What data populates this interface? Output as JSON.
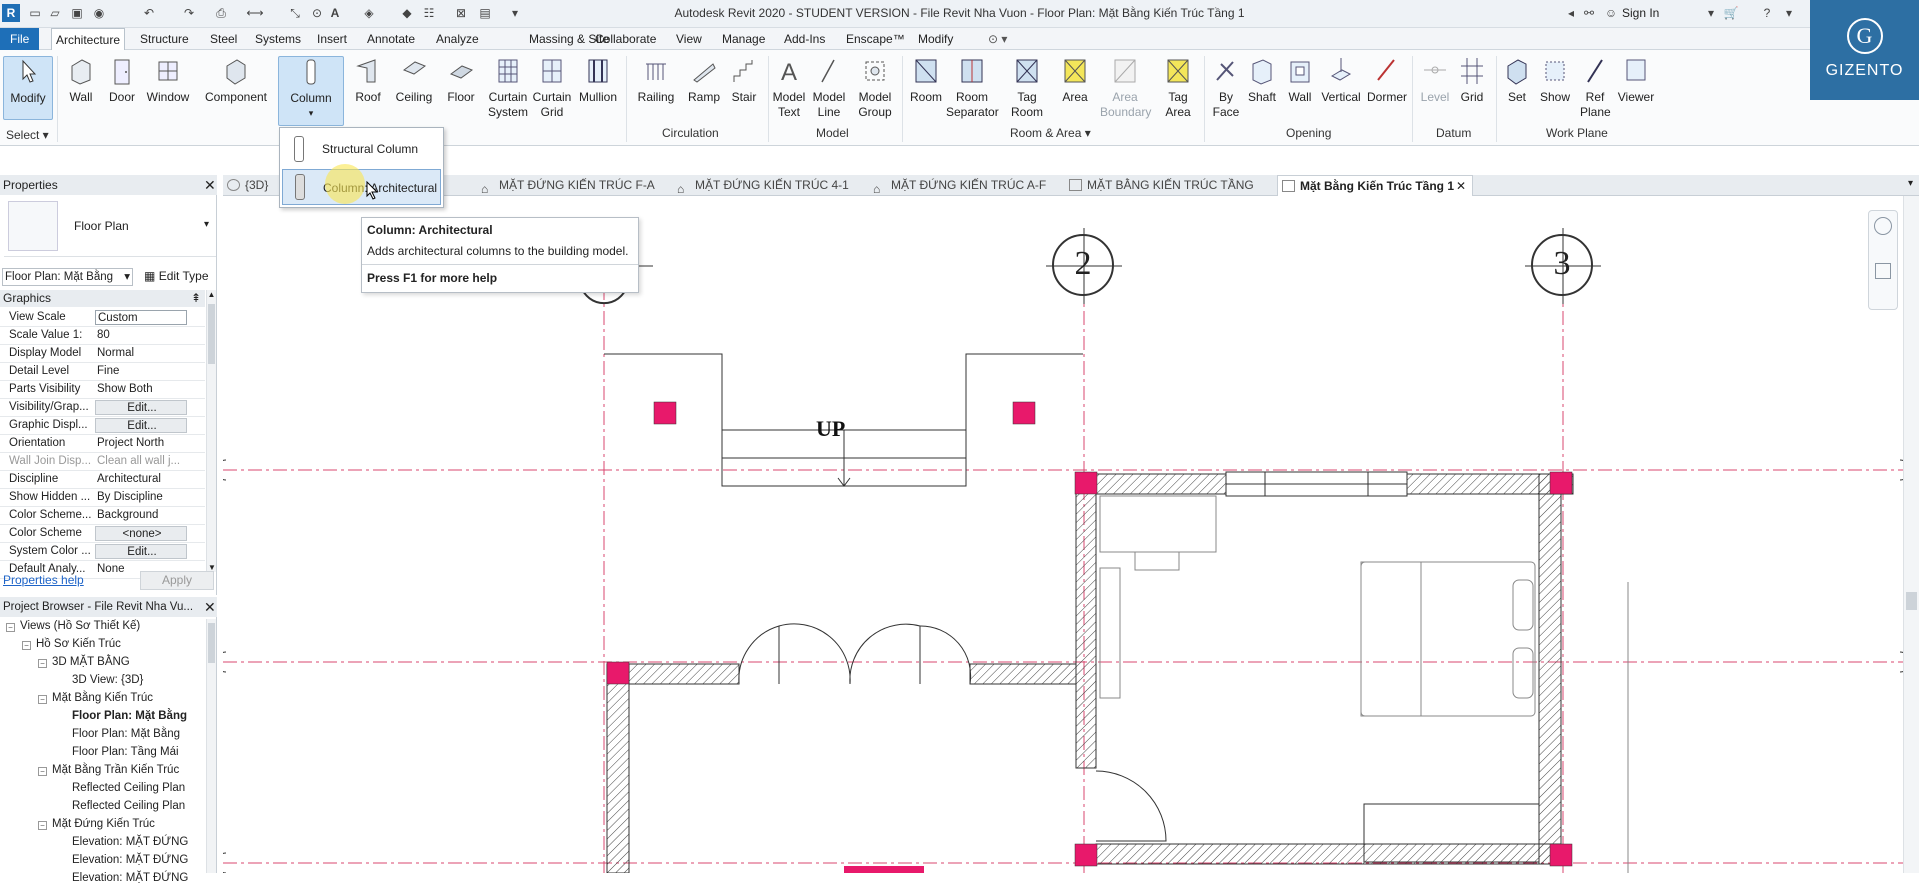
{
  "titlebar": {
    "title": "Autodesk Revit 2020 - STUDENT VERSION - File Revit Nha Vuon - Floor Plan: Mặt Bằng Kiến Trúc Tầng 1",
    "sign_in": "Sign In",
    "app_letter": "R"
  },
  "menu": {
    "items": [
      "File",
      "Architecture",
      "Structure",
      "Steel",
      "Systems",
      "Insert",
      "Annotate",
      "Analyze",
      "Massing & Site",
      "Collaborate",
      "View",
      "Manage",
      "Add-Ins",
      "Enscape™",
      "Modify"
    ]
  },
  "ribbon": {
    "buttons": {
      "modify": "Modify",
      "wall": "Wall",
      "door": "Door",
      "window": "Window",
      "component": "Component",
      "column": "Column",
      "roof": "Roof",
      "ceiling": "Ceiling",
      "floor": "Floor",
      "curtain_system": "Curtain System",
      "curtain_grid": "Curtain Grid",
      "mullion": "Mullion",
      "railing": "Railing",
      "ramp": "Ramp",
      "stair": "Stair",
      "model_text": "Model Text",
      "model_line": "Model Line",
      "model_group": "Model Group",
      "room": "Room",
      "room_separator": "Room Separator",
      "tag_room": "Tag Room",
      "area": "Area",
      "area_boundary": "Area Boundary",
      "tag_area": "Tag Area",
      "by_face": "By Face",
      "shaft": "Shaft",
      "wall_opening": "Wall",
      "vertical": "Vertical",
      "dormer": "Dormer",
      "level": "Level",
      "grid": "Grid",
      "set": "Set",
      "show": "Show",
      "ref_plane": "Ref Plane",
      "viewer": "Viewer"
    },
    "panels": {
      "select": "Select ▾",
      "circulation": "Circulation",
      "model": "Model",
      "room_area": "Room & Area ▾",
      "opening": "Opening",
      "datum": "Datum",
      "work_plane": "Work Plane"
    }
  },
  "logo": {
    "letter": "G",
    "name": "GIZENTO"
  },
  "dropdown": {
    "items": [
      "Structural Column",
      "Column: Architectural"
    ]
  },
  "tooltip": {
    "title": "Column: Architectural",
    "description": "Adds architectural columns to the building model.",
    "help": "Press F1 for more help"
  },
  "view_tabs": [
    {
      "label": "{3D}"
    },
    {
      "label": "MẶT ĐỨNG KIẾN TRÚC F-A"
    },
    {
      "label": "MẶT ĐỨNG KIẾN TRÚC 4-1"
    },
    {
      "label": "MẶT ĐỨNG KIẾN TRÚC A-F"
    },
    {
      "label": "MẶT BẰNG KIẾN TRÚC TẦNG 1"
    },
    {
      "label": "Mặt Bằng Kiến Trúc Tầng 1"
    }
  ],
  "properties": {
    "title": "Properties",
    "type_name": "Floor Plan",
    "instance_selector": "Floor Plan: Mặt Bằng",
    "edit_type": "Edit Type",
    "group": "Graphics",
    "rows": [
      {
        "key": "View Scale",
        "value": "Custom"
      },
      {
        "key": "Scale Value    1:",
        "value": "80"
      },
      {
        "key": "Display Model",
        "value": "Normal"
      },
      {
        "key": "Detail Level",
        "value": "Fine"
      },
      {
        "key": "Parts Visibility",
        "value": "Show Both"
      },
      {
        "key": "Visibility/Grap...",
        "value": "Edit..."
      },
      {
        "key": "Graphic Displ...",
        "value": "Edit..."
      },
      {
        "key": "Orientation",
        "value": "Project North"
      },
      {
        "key": "Wall Join Disp...",
        "value": "Clean all wall j..."
      },
      {
        "key": "Discipline",
        "value": "Architectural"
      },
      {
        "key": "Show Hidden ...",
        "value": "By Discipline"
      },
      {
        "key": "Color Scheme...",
        "value": "Background"
      },
      {
        "key": "Color Scheme",
        "value": "<none>"
      },
      {
        "key": "System Color ...",
        "value": "Edit..."
      },
      {
        "key": "Default Analy...",
        "value": "None"
      }
    ],
    "help_link": "Properties help",
    "apply": "Apply"
  },
  "browser": {
    "title": "Project Browser - File Revit Nha Vu...",
    "nodes": [
      "Views (Hồ Sơ Thiết Kế)",
      "Hồ Sơ Kiến Trúc",
      "3D MẶT BẰNG",
      "3D View: {3D}",
      "Mặt Bằng Kiến Trúc",
      "Floor Plan: Mặt Bằng",
      "Floor Plan: Mặt Bằng",
      "Floor Plan: Tầng Mái",
      "Mặt Bằng Trần Kiến Trúc",
      "Reflected Ceiling Plan",
      "Reflected Ceiling Plan",
      "Mặt Đứng Kiến Trúc",
      "Elevation: MẶT ĐỨNG",
      "Elevation: MẶT ĐỨNG",
      "Elevation: MẶT ĐỨNG"
    ]
  },
  "drawing": {
    "grid_labels": [
      "2",
      "3"
    ],
    "stair_label": "UP",
    "column_color": "#e8196b",
    "gridline_color": "#d9476f"
  }
}
